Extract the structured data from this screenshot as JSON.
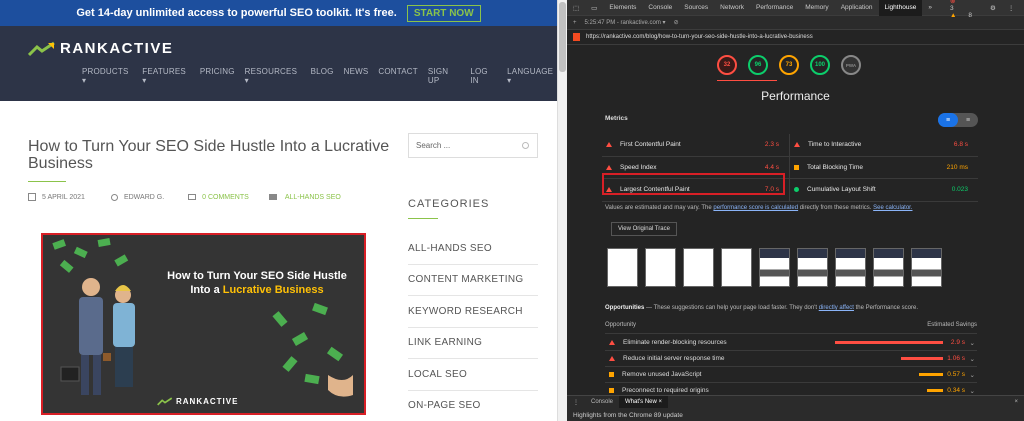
{
  "site": {
    "promo_text": "Get 14-day unlimited access to powerful SEO toolkit. It's free.",
    "promo_button": "START NOW",
    "logo_text": "RANKACTIVE",
    "nav": [
      "PRODUCTS ▾",
      "FEATURES ▾",
      "PRICING",
      "RESOURCES ▾",
      "BLOG",
      "NEWS",
      "CONTACT",
      "SIGN UP",
      "LOG IN",
      "LANGUAGE ▾"
    ],
    "title": "How to Turn Your SEO Side Hustle Into a Lucrative Business",
    "meta": {
      "date": "5 APRIL 2021",
      "author": "EDWARD G.",
      "comments": "0 COMMENTS",
      "category": "ALL-HANDS SEO"
    },
    "hero": {
      "line1": "How to Turn Your SEO Side Hustle",
      "line2_prefix": "Into a ",
      "line2_highlight": "Lucrative Business",
      "logo": "RANKACTIVE"
    },
    "search_placeholder": "Search ...",
    "categories_heading": "CATEGORIES",
    "categories": [
      "ALL-HANDS SEO",
      "CONTENT MARKETING",
      "KEYWORD RESEARCH",
      "LINK EARNING",
      "LOCAL SEO",
      "ON-PAGE SEO"
    ]
  },
  "devtools": {
    "tabs": [
      "Elements",
      "Console",
      "Sources",
      "Network",
      "Performance",
      "Memory",
      "Application",
      "Lighthouse"
    ],
    "more": "»",
    "errors": "3",
    "warnings": "8",
    "report_time": "5:25:47 PM - rankactive.com ▾",
    "url": "https://rankactive.com/blog/how-to-turn-your-seo-side-hustle-into-a-lucrative-business",
    "gauges": [
      {
        "value": "32",
        "color": "#ff4e42"
      },
      {
        "value": "96",
        "color": "#0cce6b"
      },
      {
        "value": "73",
        "color": "#ffa400"
      },
      {
        "value": "100",
        "color": "#0cce6b"
      },
      {
        "value": "PWA",
        "color": "#888888"
      }
    ],
    "performance_title": "Performance",
    "metrics_heading": "Metrics",
    "metrics": [
      {
        "label": "First Contentful Paint",
        "value": "2.3 s",
        "status": "red"
      },
      {
        "label": "Time to Interactive",
        "value": "6.8 s",
        "status": "red"
      },
      {
        "label": "Speed Index",
        "value": "4.4 s",
        "status": "red"
      },
      {
        "label": "Total Blocking Time",
        "value": "210 ms",
        "status": "orange"
      },
      {
        "label": "Largest Contentful Paint",
        "value": "7.0 s",
        "status": "red"
      },
      {
        "label": "Cumulative Layout Shift",
        "value": "0.023",
        "status": "green"
      }
    ],
    "note_prefix": "Values are estimated and may vary. The ",
    "note_link1": "performance score is calculated",
    "note_mid": " directly from these metrics. ",
    "note_link2": "See calculator.",
    "view_trace": "View Original Trace",
    "opps_title": "Opportunities",
    "opps_desc_prefix": " — These suggestions can help your page load faster. They don't ",
    "opps_desc_link": "directly affect",
    "opps_desc_suffix": " the Performance score.",
    "opp_col1": "Opportunity",
    "opp_col2": "Estimated Savings",
    "opportunities": [
      {
        "label": "Eliminate render-blocking resources",
        "value": "2.9 s",
        "status": "red",
        "fill": 0.9
      },
      {
        "label": "Reduce initial server response time",
        "value": "1.06 s",
        "status": "red",
        "fill": 0.35
      },
      {
        "label": "Remove unused JavaScript",
        "value": "0.57 s",
        "status": "orange",
        "fill": 0.2
      },
      {
        "label": "Preconnect to required origins",
        "value": "0.34 s",
        "status": "orange",
        "fill": 0.13
      }
    ],
    "drawer_tabs": [
      "Console",
      "What's New ×"
    ],
    "drawer_text": "Highlights from the Chrome 89 update"
  }
}
